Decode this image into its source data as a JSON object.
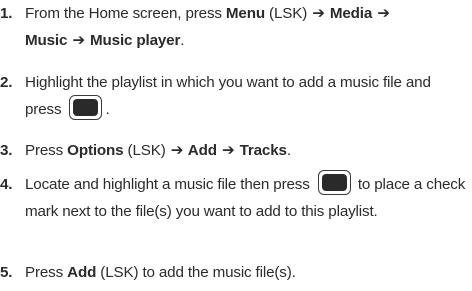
{
  "steps": [
    {
      "number": "1.",
      "t1": "From the Home screen, press ",
      "menu": "Menu",
      "t2": " (LSK) ",
      "arrow1": "➔",
      "media": " Media ",
      "arrow2": "➔",
      "music": "Music ",
      "arrow3": "➔",
      "player": " Music player",
      "t3": "."
    },
    {
      "number": "2.",
      "t1": "Highlight the playlist in which you want to add a music file and press ",
      "t2": ".",
      "key_icon": "select-key-icon"
    },
    {
      "number": "3.",
      "t1": "Press ",
      "options": "Options",
      "t2": " (LSK) ",
      "arrow1": "➔",
      "add": " Add ",
      "arrow2": "➔",
      "tracks": " Tracks",
      "t3": "."
    },
    {
      "number": "4.",
      "t1": "Locate and highlight a music file then press ",
      "t2": " to place a check mark next to the file(s) you want to add to this playlist.",
      "key_icon": "select-key-icon"
    },
    {
      "number": "5.",
      "t1": "Press ",
      "add": "Add",
      "t2": " (LSK) to add the music file(s)."
    }
  ]
}
